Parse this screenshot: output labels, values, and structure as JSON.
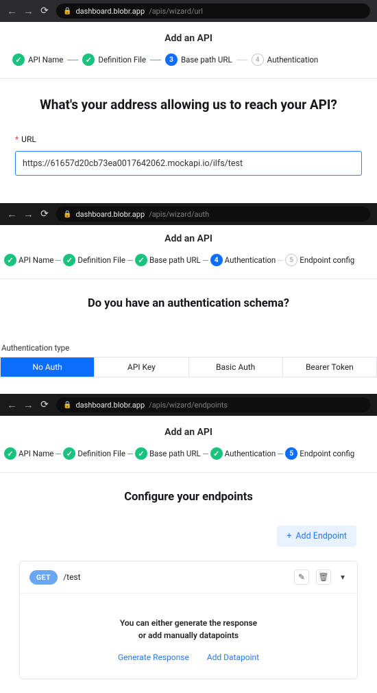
{
  "browser1": {
    "domain": "dashboard.blobr.app",
    "path": "/apis/wizard/url"
  },
  "browser2": {
    "domain": "dashboard.blobr.app",
    "path": "/apis/wizard/auth"
  },
  "browser3": {
    "domain": "dashboard.blobr.app",
    "path": "/apis/wizard/endpoints"
  },
  "header_title": "Add an API",
  "steps": {
    "s1": "API Name",
    "s2": "Definition File",
    "s3": "Base path URL",
    "s4": "Authentication",
    "s5": "Endpoint config",
    "n3": "3",
    "n4": "4",
    "n5": "5"
  },
  "panel_url": {
    "headline": "What's your address allowing us to reach your API?",
    "label": "URL",
    "value": "https://61657d20cb73ea0017642062.mockapi.io/ilfs/test"
  },
  "panel_auth": {
    "headline": "Do you have an authentication schema?",
    "seg_label": "Authentication type",
    "options": {
      "o1": "No Auth",
      "o2": "API Key",
      "o3": "Basic Auth",
      "o4": "Bearer Token"
    }
  },
  "panel_ep": {
    "headline": "Configure your endpoints",
    "add_btn": "Add Endpoint",
    "method": "GET",
    "path": "/test",
    "body1": "You can either generate the response",
    "body2": "or add manually datapoints",
    "link1": "Generate Response",
    "link2": "Add Datapoint"
  }
}
